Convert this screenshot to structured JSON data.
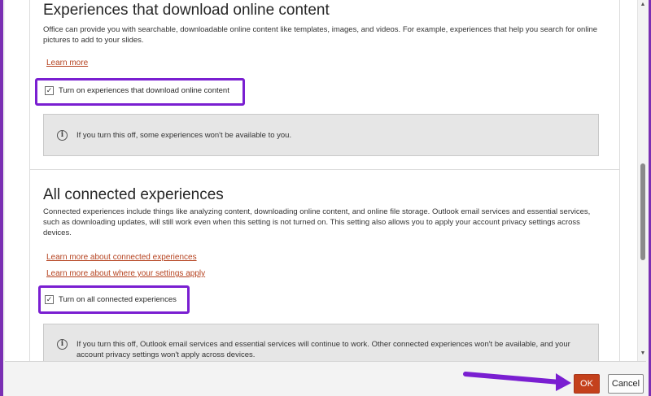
{
  "sections": {
    "online_content": {
      "title": "Experiences that download online content",
      "description": "Office can provide you with searchable, downloadable online content like templates, images, and videos. For example, experiences that help you search for online pictures to add to your slides.",
      "learn_more": "Learn more",
      "checkbox_label": "Turn on experiences that download online content",
      "checkbox_checked": true,
      "info": "If you turn this off, some experiences won't be available to you."
    },
    "connected": {
      "title": "All connected experiences",
      "description": "Connected experiences include things like analyzing content, downloading online content, and online file storage. Outlook email services and essential services, such as downloading updates, will still work even when this setting is not turned on. This setting also allows you to apply your account privacy settings across devices.",
      "link_1": "Learn more about connected experiences",
      "link_2": "Learn more about where your settings apply",
      "checkbox_label": "Turn on all connected experiences",
      "checkbox_checked": true,
      "info": "If you turn this off, Outlook email services and essential services will continue to work. Other connected experiences won't be available, and your account privacy settings won't apply across devices."
    }
  },
  "icons": {
    "check": "✓",
    "info": "i",
    "scroll_up": "▲",
    "scroll_down": "▼"
  },
  "footer": {
    "ok_label": "OK",
    "cancel_label": "Cancel"
  },
  "colors": {
    "highlight": "#7a1fd1",
    "link": "#b5421f",
    "ok_button": "#c4411c"
  }
}
